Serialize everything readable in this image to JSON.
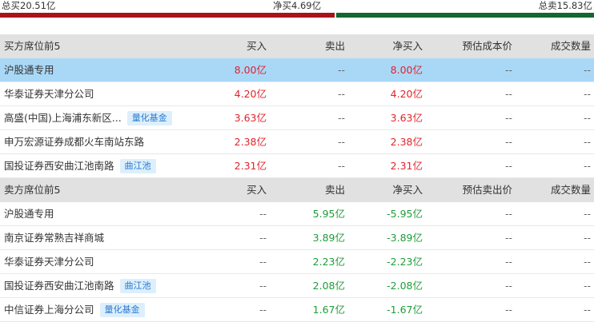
{
  "summary": {
    "total_buy": "总买20.51亿",
    "net_buy": "净买4.69亿",
    "total_sell": "总卖15.83亿",
    "buy_share": 0.565
  },
  "buy_table": {
    "headers": [
      "买方席位前5",
      "买入",
      "卖出",
      "净买入",
      "预估成本价",
      "成交数量"
    ],
    "rows": [
      {
        "name": "沪股通专用",
        "tag": "",
        "buy": "8.00亿",
        "sell": "--",
        "net": "8.00亿",
        "est": "--",
        "volume": "--"
      },
      {
        "name": "华泰证券天津分公司",
        "tag": "",
        "buy": "4.20亿",
        "sell": "--",
        "net": "4.20亿",
        "est": "--",
        "volume": "--"
      },
      {
        "name": "高盛(中国)上海浦东新区...",
        "tag": "量化基金",
        "buy": "3.63亿",
        "sell": "--",
        "net": "3.63亿",
        "est": "--",
        "volume": "--"
      },
      {
        "name": "申万宏源证券成都火车南站东路",
        "tag": "",
        "buy": "2.38亿",
        "sell": "--",
        "net": "2.38亿",
        "est": "--",
        "volume": "--"
      },
      {
        "name": "国投证券西安曲江池南路",
        "tag": "曲江池",
        "buy": "2.31亿",
        "sell": "--",
        "net": "2.31亿",
        "est": "--",
        "volume": "--"
      }
    ]
  },
  "sell_table": {
    "headers": [
      "卖方席位前5",
      "买入",
      "卖出",
      "净买入",
      "预估卖出价",
      "成交数量"
    ],
    "rows": [
      {
        "name": "沪股通专用",
        "tag": "",
        "buy": "--",
        "sell": "5.95亿",
        "net": "-5.95亿",
        "est": "--",
        "volume": "--"
      },
      {
        "name": "南京证券常熟吉祥商城",
        "tag": "",
        "buy": "--",
        "sell": "3.89亿",
        "net": "-3.89亿",
        "est": "--",
        "volume": "--"
      },
      {
        "name": "华泰证券天津分公司",
        "tag": "",
        "buy": "--",
        "sell": "2.23亿",
        "net": "-2.23亿",
        "est": "--",
        "volume": "--"
      },
      {
        "name": "国投证券西安曲江池南路",
        "tag": "曲江池",
        "buy": "--",
        "sell": "2.08亿",
        "net": "-2.08亿",
        "est": "--",
        "volume": "--"
      },
      {
        "name": "中信证券上海分公司",
        "tag": "量化基金",
        "buy": "--",
        "sell": "1.67亿",
        "net": "-1.67亿",
        "est": "--",
        "volume": "--"
      }
    ]
  },
  "colors": {
    "buy_bar": "#a8131b",
    "sell_bar": "#13672f",
    "positive": "#e3222b",
    "negative": "#1d9d38",
    "highlight_row": "#a9d8f7",
    "header_bg": "#e1e1e1",
    "tag_bg": "#ddeffc",
    "tag_text": "#2a7bd1"
  }
}
